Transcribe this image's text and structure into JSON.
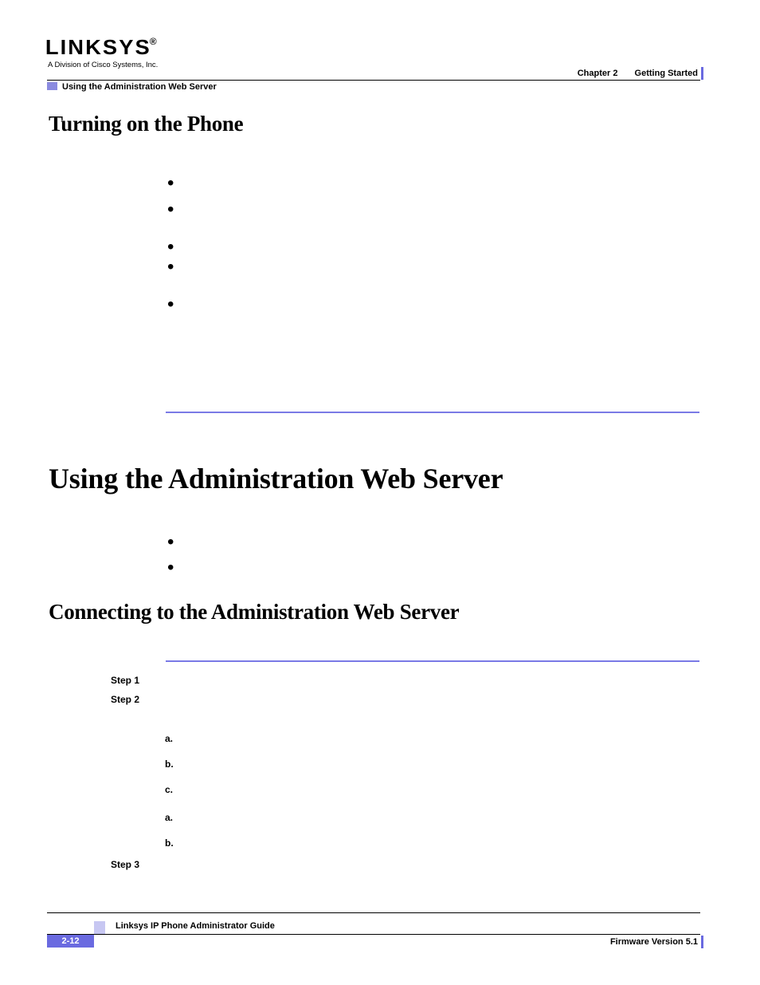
{
  "logo": {
    "word": "LINKSYS",
    "reg": "®",
    "sub": "A Division of Cisco Systems, Inc."
  },
  "header": {
    "chapter_label": "Chapter 2",
    "chapter_title": "Getting Started",
    "running_head": "Using the Administration Web Server"
  },
  "sections": {
    "turning": "Turning on the Phone",
    "using": "Using the Administration Web Server",
    "connecting": "Connecting to the Administration Web Server"
  },
  "bullets": {
    "dot": "•"
  },
  "steps": {
    "s1": "Step 1",
    "s2": "Step 2",
    "s3": "Step 3",
    "a": "a.",
    "b": "b.",
    "c": "c."
  },
  "footer": {
    "guide": "Linksys IP Phone Administrator Guide",
    "page": "2-12",
    "version": "Firmware Version 5.1"
  }
}
